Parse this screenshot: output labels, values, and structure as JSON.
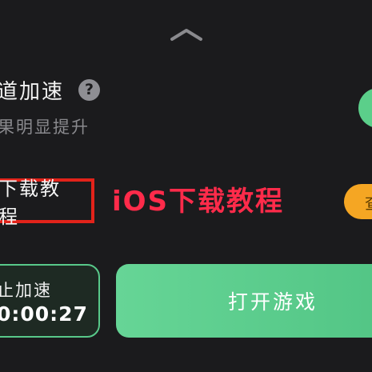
{
  "panel": {
    "collapse_icon": "chevron-up-icon"
  },
  "acceleration": {
    "title": "道加速",
    "help_icon": "?",
    "subtitle": "果明显提升",
    "toggle_on": true
  },
  "tutorial": {
    "link_label": "下载教程",
    "annotation": "iOS下载教程",
    "side_button_label": "查"
  },
  "actions": {
    "stop_label": "止加速",
    "stop_timer": "0:00:27",
    "open_game_label": "打开游戏"
  },
  "colors": {
    "background": "#1b1b1d",
    "accent_green": "#5bcf8a",
    "highlight_red": "#e2231a",
    "annotation_red": "#ff2b4a",
    "orange": "#f5a623"
  }
}
